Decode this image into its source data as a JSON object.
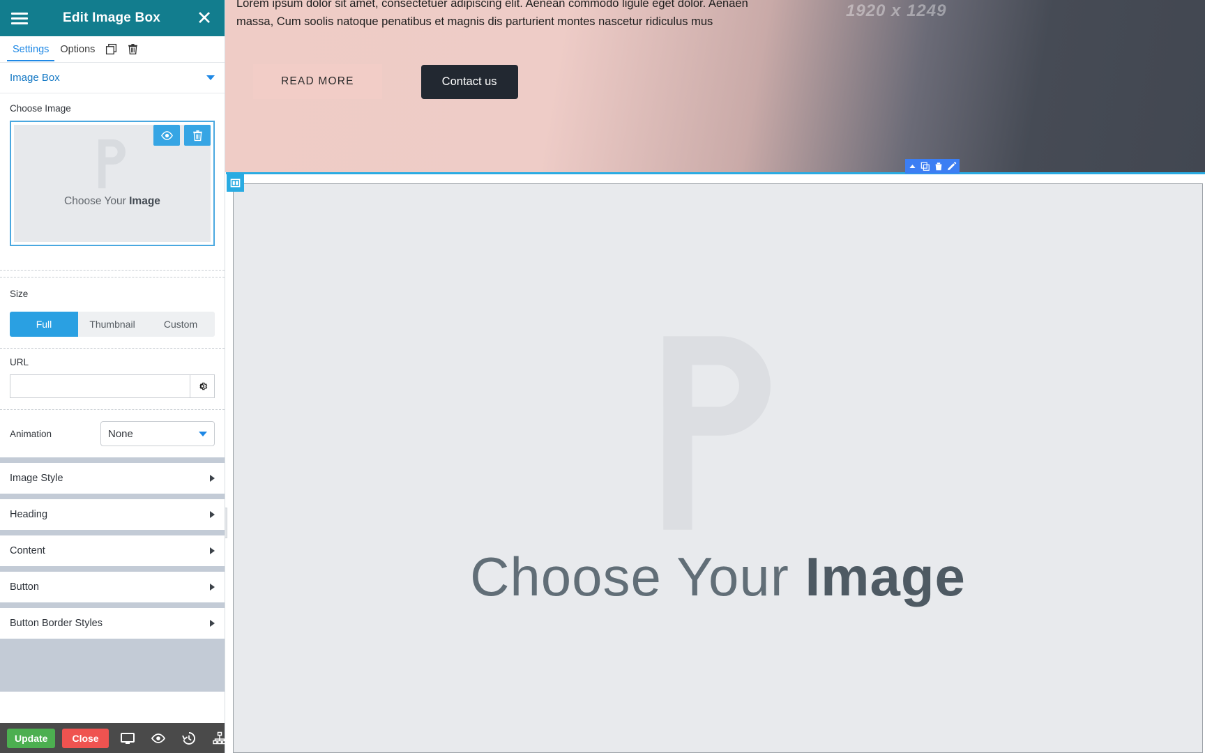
{
  "panel": {
    "title": "Edit Image Box",
    "menu_icon": "hamburger-icon",
    "close_icon": "close-icon",
    "tabs": [
      {
        "label": "Settings",
        "active": true
      },
      {
        "label": "Options",
        "active": false
      }
    ],
    "tab_actions": [
      {
        "icon": "duplicate-icon"
      },
      {
        "icon": "trash-icon"
      }
    ],
    "section": {
      "title": "Image Box"
    },
    "choose_image": {
      "label": "Choose Image",
      "caption_prefix": "Choose  Your ",
      "caption_bold": "Image",
      "preview_icon": "eye-icon",
      "delete_icon": "trash-icon"
    },
    "size": {
      "label": "Size",
      "options": [
        "Full",
        "Thumbnail",
        "Custom"
      ],
      "selected": "Full"
    },
    "url": {
      "label": "URL",
      "value": "",
      "placeholder": "",
      "settings_icon": "gear-icon"
    },
    "animation": {
      "label": "Animation",
      "value": "None"
    },
    "accordions": [
      {
        "label": "Image Style"
      },
      {
        "label": "Heading"
      },
      {
        "label": "Content"
      },
      {
        "label": "Button"
      },
      {
        "label": "Button Border Styles"
      }
    ],
    "footer": {
      "update_label": "Update",
      "close_label": "Close",
      "icons": [
        "monitor-icon",
        "eye-icon",
        "history-icon",
        "sitemap-icon"
      ]
    }
  },
  "canvas": {
    "hero": {
      "paragraph": "Lorem ipsum dolor sit amet, consectetuer adipiscing elit. Aenean commodo ligule eget dolor. Aenaen massa, Cum soolis natoque penatibus et magnis dis parturient montes nascetur ridiculus mus",
      "watermark": "1920 x 1249",
      "read_more_label": "READ MORE",
      "contact_label": "Contact us"
    },
    "element_toolbar": {
      "icons": [
        "collapse-up-icon",
        "duplicate-icon",
        "trash-icon",
        "edit-pencil-icon"
      ]
    },
    "section": {
      "handle_icon": "section-handle-icon",
      "caption_prefix": "Choose  Your ",
      "caption_bold": "Image"
    },
    "collapse_handle_icon": "chevron-left-icon"
  },
  "colors": {
    "panel_header": "#127d8e",
    "accent_blue": "#2aa0e2",
    "link_blue": "#1277c4",
    "update_green": "#4caf50",
    "close_red": "#ef5350",
    "section_blue": "#29abe2",
    "toolbar_blue": "#3c7ef3",
    "footer_dark": "#4a4a4a"
  }
}
